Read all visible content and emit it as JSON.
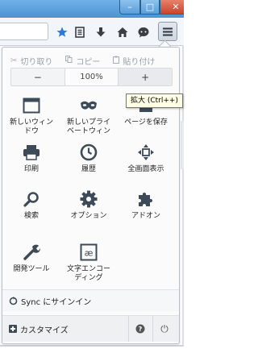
{
  "window": {
    "controls": {
      "minimize": "–",
      "maximize": "□",
      "close": "✕"
    }
  },
  "toolbar": {
    "icons": [
      "star-icon",
      "reading-list-icon",
      "download-icon",
      "home-icon",
      "chat-icon",
      "menu-icon"
    ]
  },
  "edit": {
    "cut": "切り取り",
    "copy": "コピー",
    "paste": "貼り付け"
  },
  "zoom": {
    "out": "−",
    "level": "100%",
    "in": "+"
  },
  "tooltip": "拡大 (Ctrl++)",
  "items": [
    {
      "label": "新しいウィン\nドウ",
      "icon": "new-window-icon"
    },
    {
      "label": "新しいプライ\nベートウィン",
      "icon": "private-window-icon"
    },
    {
      "label": "ページを保存",
      "icon": "save-page-icon"
    },
    {
      "label": "印刷",
      "icon": "print-icon"
    },
    {
      "label": "履歴",
      "icon": "history-icon"
    },
    {
      "label": "全画面表示",
      "icon": "fullscreen-icon"
    },
    {
      "label": "検索",
      "icon": "search-icon"
    },
    {
      "label": "オプション",
      "icon": "options-gear-icon"
    },
    {
      "label": "アドオン",
      "icon": "addons-puzzle-icon"
    },
    {
      "label": "開発ツール",
      "icon": "developer-wrench-icon"
    },
    {
      "label": "文字エンコー\nディング",
      "icon": "text-encoding-icon"
    }
  ],
  "footer": {
    "sync": "Sync にサインイン",
    "customize": "カスタマイズ",
    "help": "?",
    "quit": "⏻"
  },
  "colors": {
    "titlebar": "#5a9fd9",
    "close": "#c9452b",
    "star": "#2a7ad6",
    "icon": "#3d4a57"
  }
}
